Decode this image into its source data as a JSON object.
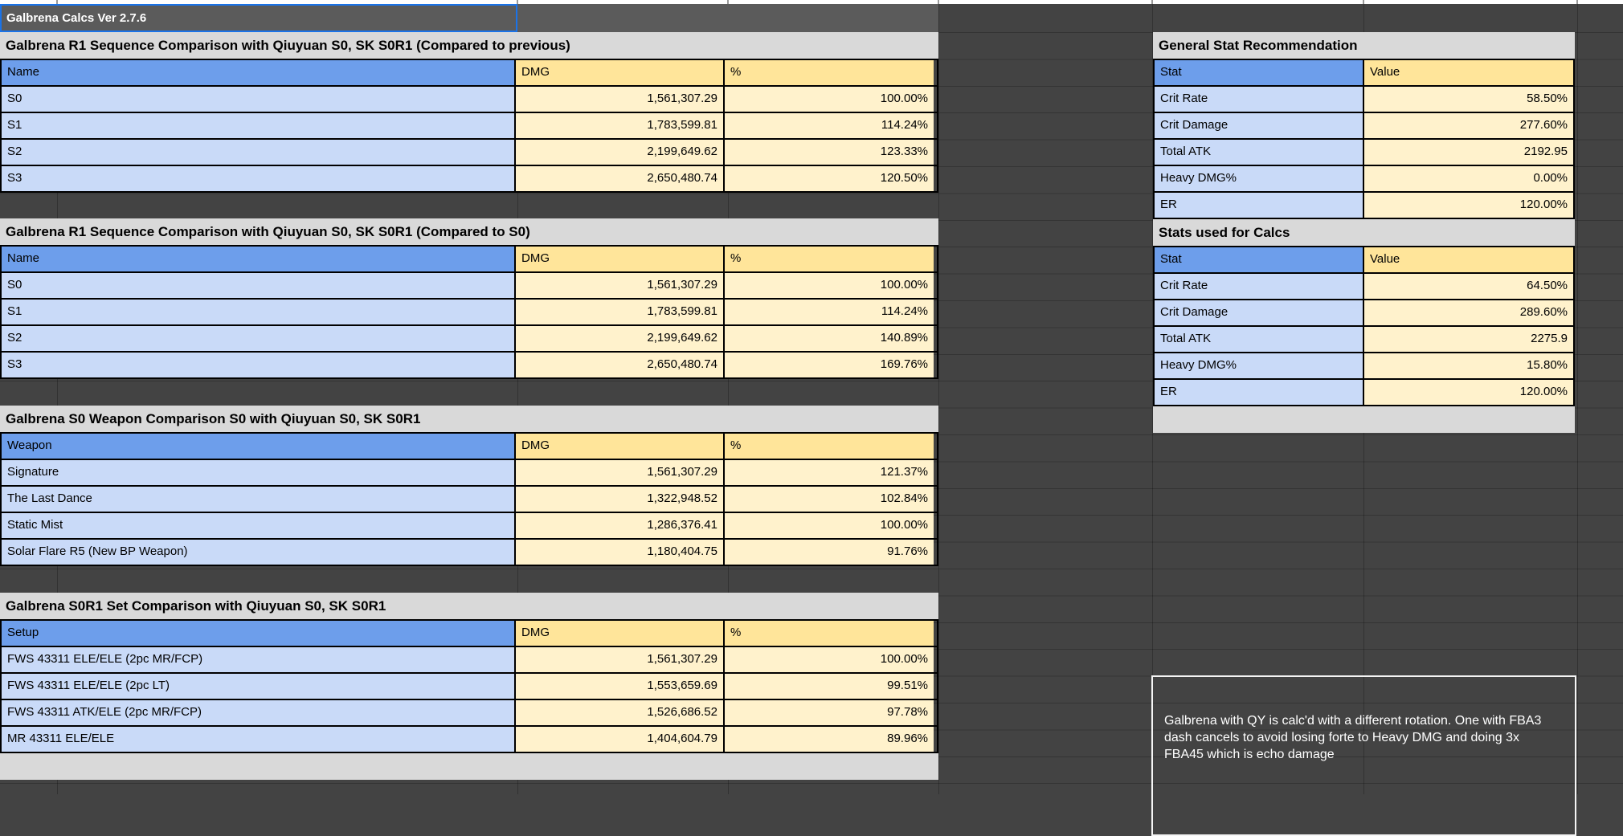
{
  "sheet": {
    "version_cell": "Galbrena Calcs Ver 2.7.6"
  },
  "colors": {
    "header_blue": "#6d9eeb",
    "cell_blue": "#c9daf8",
    "header_yellow": "#ffe59a",
    "cell_yellow": "#fff2cc",
    "title_gray": "#d9d9d9",
    "version_gray": "#5b5b5b",
    "selection_blue": "#1a73e8",
    "canvas_dark": "#434343"
  },
  "left_tables": [
    {
      "title": "Galbrena R1 Sequence Comparison with Qiuyuan S0, SK S0R1 (Compared to previous)",
      "columns": [
        "Name",
        "DMG",
        "%"
      ],
      "rows": [
        {
          "name": "S0",
          "dmg": "1,561,307.29",
          "pct": "100.00%"
        },
        {
          "name": "S1",
          "dmg": "1,783,599.81",
          "pct": "114.24%"
        },
        {
          "name": "S2",
          "dmg": "2,199,649.62",
          "pct": "123.33%"
        },
        {
          "name": "S3",
          "dmg": "2,650,480.74",
          "pct": "120.50%"
        }
      ]
    },
    {
      "title": "Galbrena R1 Sequence Comparison with Qiuyuan S0, SK S0R1 (Compared to S0)",
      "columns": [
        "Name",
        "DMG",
        "%"
      ],
      "rows": [
        {
          "name": "S0",
          "dmg": "1,561,307.29",
          "pct": "100.00%"
        },
        {
          "name": "S1",
          "dmg": "1,783,599.81",
          "pct": "114.24%"
        },
        {
          "name": "S2",
          "dmg": "2,199,649.62",
          "pct": "140.89%"
        },
        {
          "name": "S3",
          "dmg": "2,650,480.74",
          "pct": "169.76%"
        }
      ]
    },
    {
      "title": "Galbrena S0 Weapon Comparison S0 with Qiuyuan S0, SK S0R1",
      "columns": [
        "Weapon",
        "DMG",
        "%"
      ],
      "rows": [
        {
          "name": "Signature",
          "dmg": "1,561,307.29",
          "pct": "121.37%"
        },
        {
          "name": "The Last Dance",
          "dmg": "1,322,948.52",
          "pct": "102.84%"
        },
        {
          "name": "Static Mist",
          "dmg": "1,286,376.41",
          "pct": "100.00%"
        },
        {
          "name": "Solar Flare R5 (New BP Weapon)",
          "dmg": "1,180,404.75",
          "pct": "91.76%"
        }
      ]
    },
    {
      "title": "Galbrena S0R1 Set Comparison with Qiuyuan S0, SK S0R1",
      "columns": [
        "Setup",
        "DMG",
        "%"
      ],
      "rows": [
        {
          "name": "FWS 43311 ELE/ELE (2pc MR/FCP)",
          "dmg": "1,561,307.29",
          "pct": "100.00%"
        },
        {
          "name": "FWS 43311 ELE/ELE (2pc LT)",
          "dmg": "1,553,659.69",
          "pct": "99.51%"
        },
        {
          "name": "FWS 43311 ATK/ELE (2pc MR/FCP)",
          "dmg": "1,526,686.52",
          "pct": "97.78%"
        },
        {
          "name": "MR 43311 ELE/ELE",
          "dmg": "1,404,604.79",
          "pct": "89.96%"
        }
      ]
    }
  ],
  "right_tables": [
    {
      "title": "General Stat Recommendation",
      "columns": [
        "Stat",
        "Value"
      ],
      "rows": [
        {
          "stat": "Crit Rate",
          "value": "58.50%"
        },
        {
          "stat": "Crit Damage",
          "value": "277.60%"
        },
        {
          "stat": "Total ATK",
          "value": "2192.95"
        },
        {
          "stat": "Heavy DMG%",
          "value": "0.00%"
        },
        {
          "stat": "ER",
          "value": "120.00%"
        }
      ]
    },
    {
      "title": "Stats used for Calcs",
      "columns": [
        "Stat",
        "Value"
      ],
      "rows": [
        {
          "stat": "Crit Rate",
          "value": "64.50%"
        },
        {
          "stat": "Crit Damage",
          "value": "289.60%"
        },
        {
          "stat": "Total ATK",
          "value": "2275.9"
        },
        {
          "stat": "Heavy DMG%",
          "value": "15.80%"
        },
        {
          "stat": "ER",
          "value": "120.00%"
        }
      ]
    }
  ],
  "note": {
    "text": "Galbrena with QY is calc'd with a different rotation. One with FBA3 dash cancels to avoid losing forte to Heavy DMG and doing 3x FBA45 which is echo damage"
  }
}
